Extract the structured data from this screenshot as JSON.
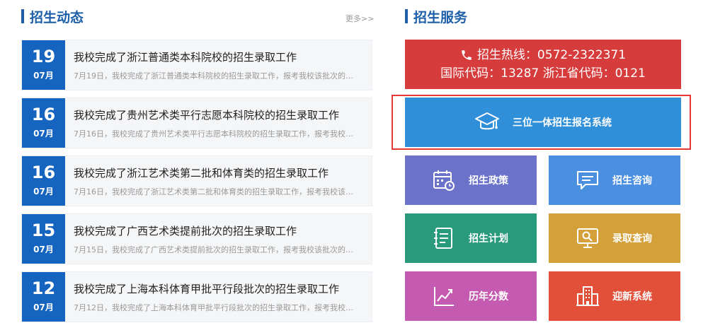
{
  "left": {
    "title": "招生动态",
    "more": "更多>>",
    "news": [
      {
        "day": "19",
        "month": "07月",
        "title": "我校完成了浙江普通类本科院校的招生录取工作",
        "summary": "7月19日，我校完成了浙江普通类本科院校的招生录取工作，报考我校该批次的考..."
      },
      {
        "day": "16",
        "month": "07月",
        "title": "我校完成了贵州艺术类平行志愿本科院校的招生录取工作",
        "summary": "7月16日，我校完成了贵州艺术类平行志愿本科院校的招生录取工作，报考我校该..."
      },
      {
        "day": "16",
        "month": "07月",
        "title": "我校完成了浙江艺术类第二批和体育类的招生录取工作",
        "summary": "7月16日，我校完成了浙江艺术类第二批和体育类的招生录取工作，报考我校该批..."
      },
      {
        "day": "15",
        "month": "07月",
        "title": "我校完成了广西艺术类提前批次的招生录取工作",
        "summary": "7月15日，我校完成了广西艺术类提前批次的招生录取工作，报考我校该批次的考..."
      },
      {
        "day": "12",
        "month": "07月",
        "title": "我校完成了上海本科体育甲批平行段批次的招生录取工作",
        "summary": "7月12日，我校完成了上海本科体育甲批平行段批次的招生录取工作，报考我校该..."
      }
    ]
  },
  "right": {
    "title": "招生服务",
    "hotline_line1": "招生热线：0572-2322371",
    "hotline_line2": "国际代码：13287 浙江省代码：0121",
    "system_label": "三位一体招生报名系统",
    "tiles": [
      {
        "label": "招生政策",
        "color": "#6a72c9",
        "icon": "calendar-icon"
      },
      {
        "label": "招生咨询",
        "color": "#4a8fe0",
        "icon": "chat-icon"
      },
      {
        "label": "招生计划",
        "color": "#2a9a7c",
        "icon": "list-icon"
      },
      {
        "label": "录取查询",
        "color": "#d4a03a",
        "icon": "search-monitor-icon"
      },
      {
        "label": "历年分数",
        "color": "#c45bb0",
        "icon": "chart-icon"
      },
      {
        "label": "迎新系统",
        "color": "#e35039",
        "icon": "building-icon"
      }
    ]
  },
  "colors": {
    "brand": "#1d5fa8",
    "date_bg": "#1565c0",
    "hotline": "#d63c3c",
    "system": "#2f8fd8",
    "highlight": "#e53935"
  }
}
